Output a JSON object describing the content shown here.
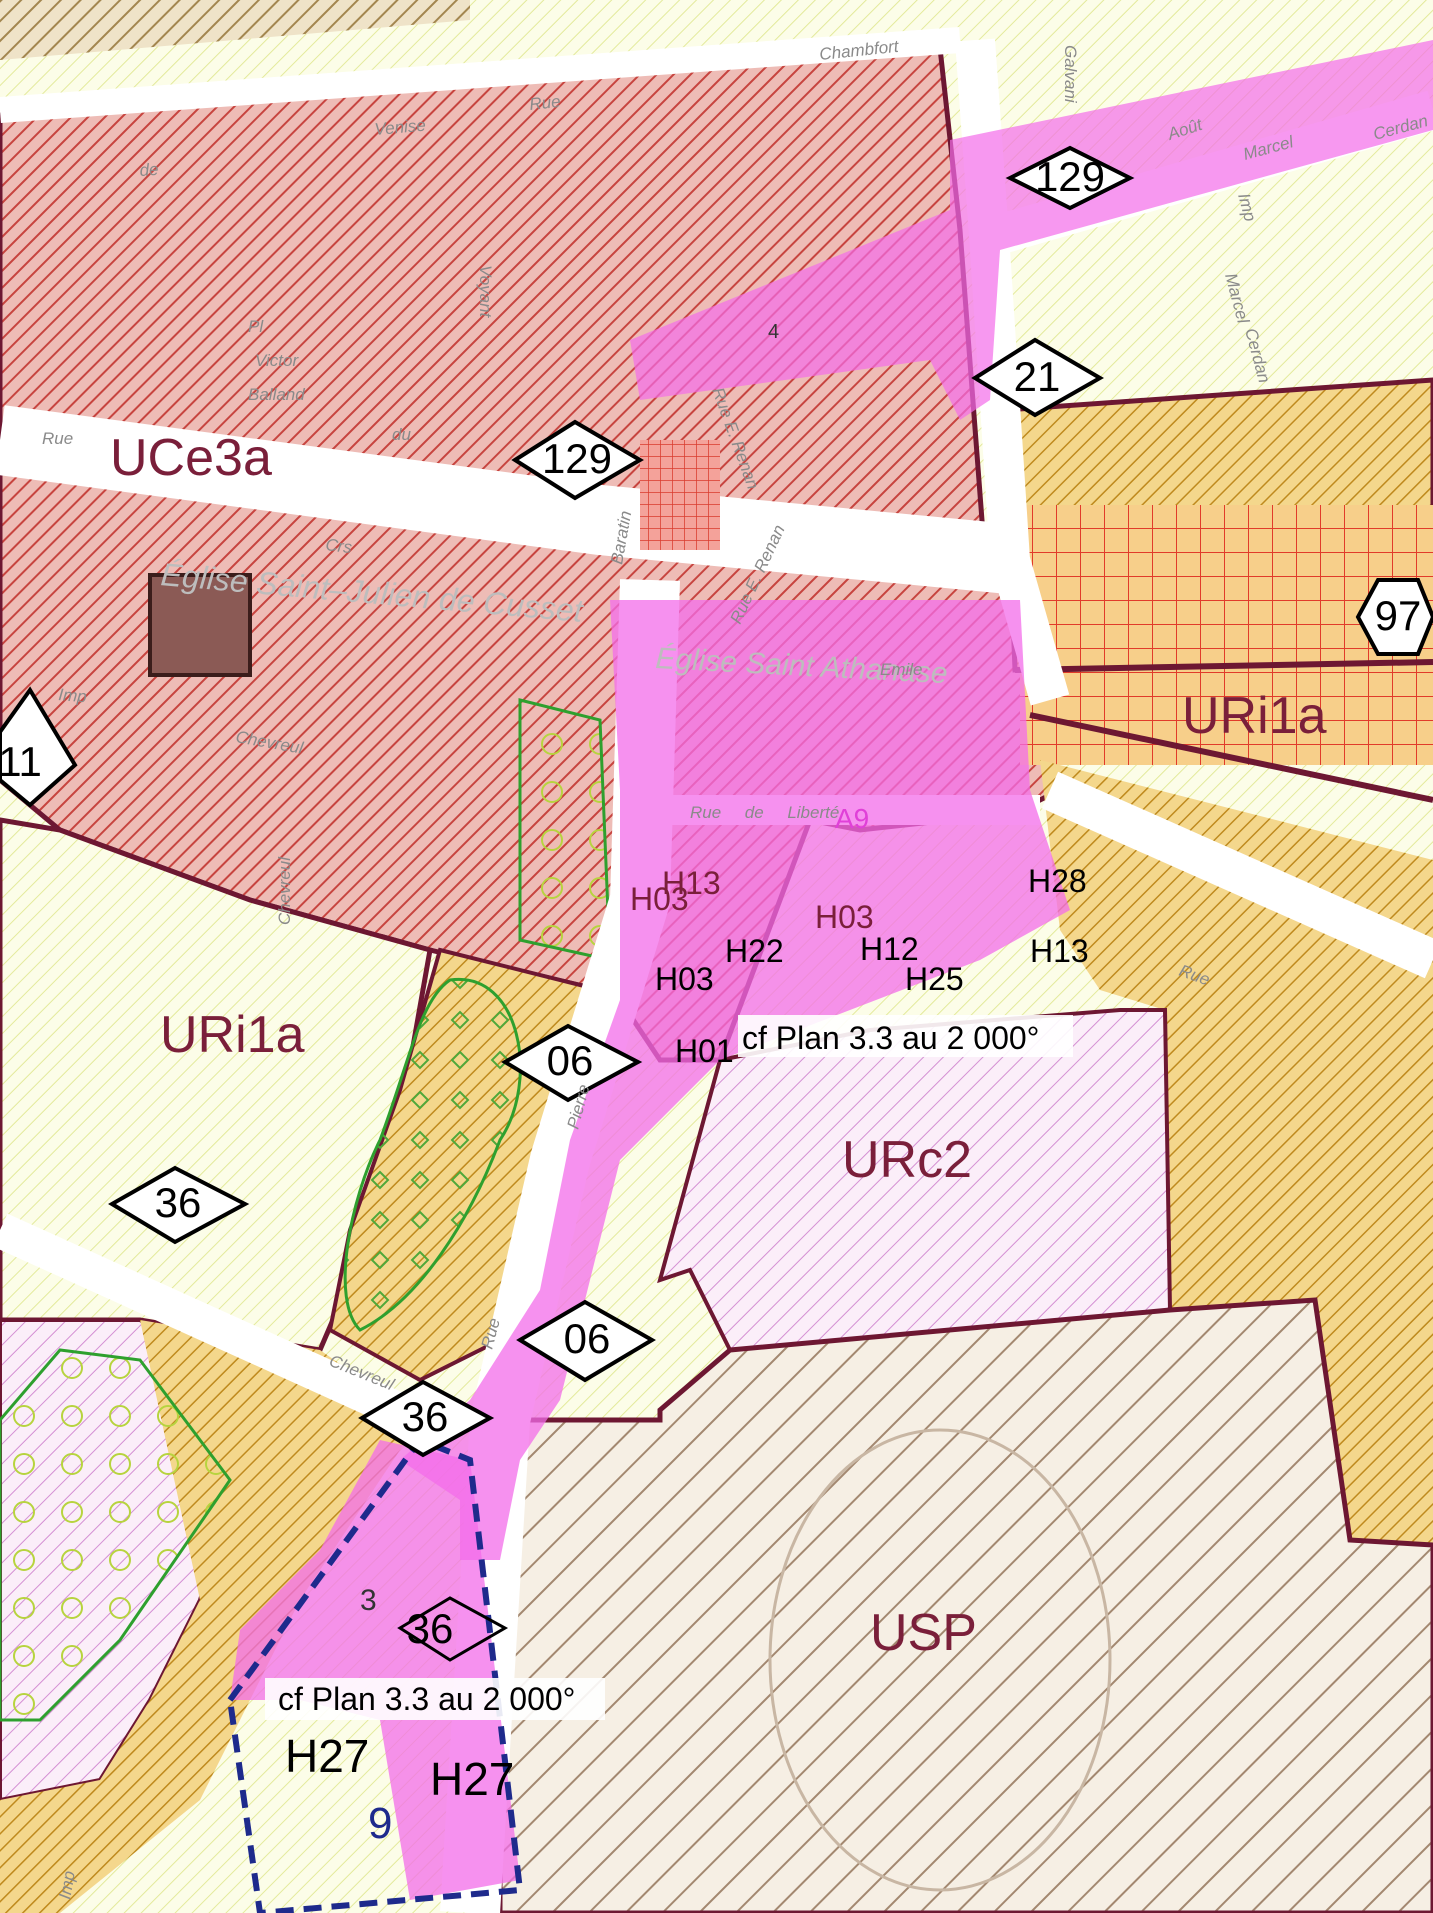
{
  "map": {
    "colors": {
      "road": "#ffffff",
      "road_edge": "#b8b8b8",
      "urban_hatch": "#c7443f",
      "urban_fill": "#e9a9a1",
      "yellow_fill": "#f4d78c",
      "yellow_hatch": "#bf8a1e",
      "pink_overlay": "#f36ce9",
      "zone_border": "#6d1732",
      "light_hatch": "#dfe97c",
      "green_outline": "#2ea02e",
      "building_gray": "#c6c6c6",
      "usp_hatch": "#a38870",
      "urc2_hatch": "#d48fd3"
    },
    "zones": {
      "uce3a": "UCe3a",
      "uri1a_left": "URi1a",
      "uri1a_right": "URi1a",
      "urc2": "URc2",
      "usp": "USP"
    },
    "hex_labels": {
      "h129_top": "129",
      "h21": "21",
      "h129_mid": "129",
      "h97": "97",
      "h11": "11",
      "h06_a": "06",
      "h36_a": "36",
      "h06_b": "06",
      "h36_b": "36",
      "h36_c": "36"
    },
    "streets": {
      "chambfort": "Chambfort",
      "rue_top": "Rue",
      "venise": "Venise",
      "de_top": "de",
      "galvani": "Galvani",
      "aout": "Août",
      "marcel_top": "Marcel",
      "cerdan_top": "Cerdan",
      "imp": "Imp",
      "marcel_v": "Marcel",
      "cerdan_v": "Cerdan",
      "voyant": "Voyant",
      "pl": "Pl",
      "victor": "Victor",
      "balland": "Balland",
      "rue_left": "Rue",
      "du": "du",
      "crs": "Crs",
      "saint_julien": "Église Saint–Julien  de Cusset",
      "baratin": "Baratin",
      "rue_renan1": "Rue E. Renan",
      "rue_renan2": "Rue E. Renan",
      "saint_athan": "Église Saint Athanase",
      "emile": "Emile",
      "rue_liberte": "Rue     de     Liberté",
      "chevreul_1": "Chevreul",
      "imp_left": "Imp",
      "chevreul_v": "Chevreul",
      "chevreul_2": "Chevreul",
      "rue_pierre": "Rue",
      "pierre": "Pierre",
      "rue_right": "Rue",
      "imp_bottom": "Imp"
    },
    "plan_refs": {
      "top": "cf Plan 3.3 au 2 000°",
      "bottom": "cf Plan 3.3 au 2 000°"
    },
    "heritage": {
      "h13_a": "H13",
      "h03_a": "H03",
      "h03_b": "H03",
      "h28": "H28",
      "h25": "H25",
      "h13_b": "H13",
      "h12": "H12",
      "h01": "H01",
      "h03_c": "H03",
      "h27_a": "H27",
      "h27_b": "H27",
      "h22": "H22",
      "n9": "9",
      "a9": "A9",
      "n4": "4",
      "n3": "3"
    }
  }
}
